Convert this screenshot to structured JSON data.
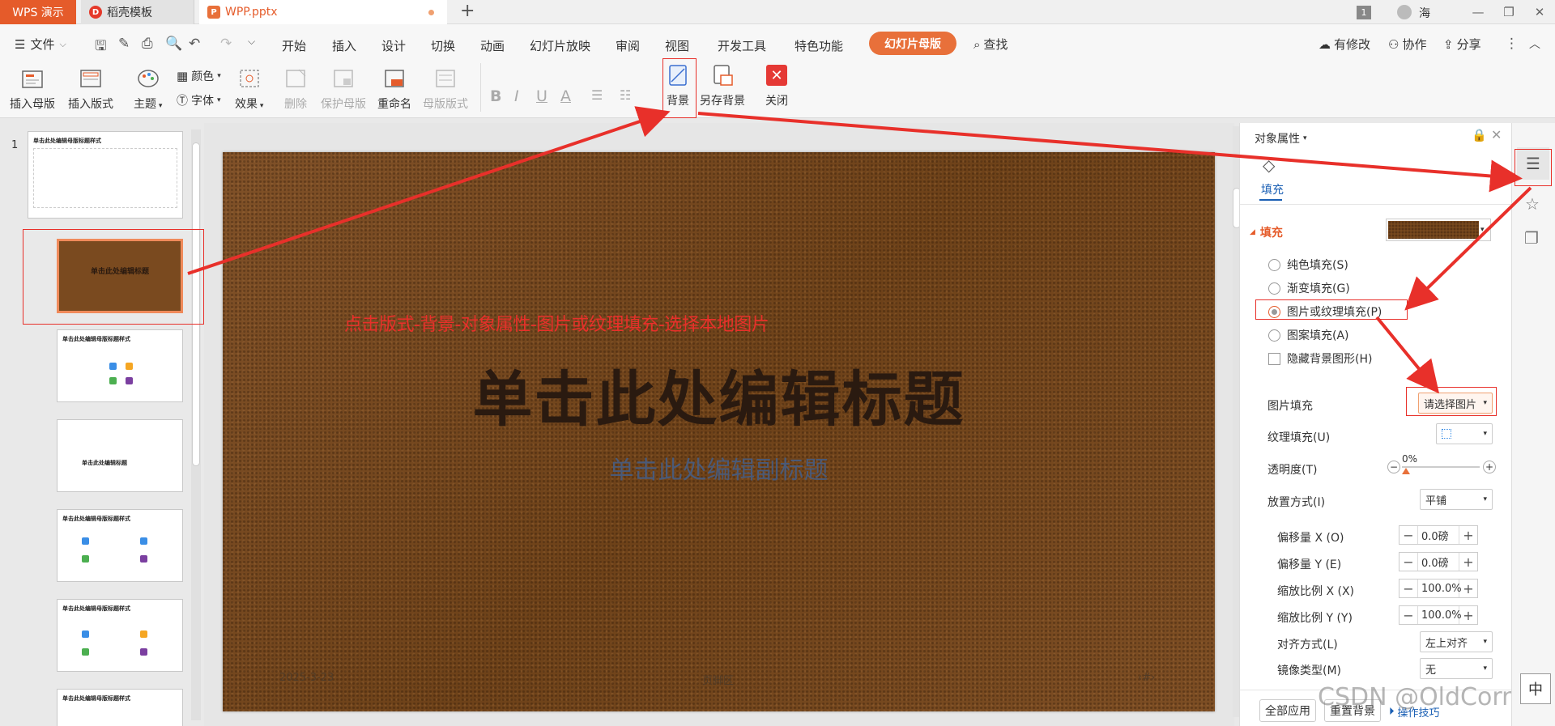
{
  "titlebar": {
    "brand": "WPS 演示",
    "tab1": "稻壳模板",
    "tab2": "WPP.pptx",
    "new_tab": "+",
    "page_num": "1",
    "user": "海",
    "min": "—",
    "restore": "❐",
    "close": "✕"
  },
  "menu": {
    "file": "文件",
    "items": [
      "开始",
      "插入",
      "设计",
      "切换",
      "动画",
      "幻灯片放映",
      "审阅",
      "视图",
      "开发工具",
      "特色功能"
    ],
    "active": "幻灯片母版",
    "search": "查找",
    "modified": "有修改",
    "collab": "协作",
    "share": "分享",
    "more": "⋮",
    "collapse": "︿"
  },
  "ribbon": {
    "insert_master": "插入母版",
    "insert_layout": "插入版式",
    "theme": "主题",
    "color": "颜色",
    "font": "字体",
    "effect": "效果",
    "delete": "删除",
    "protect": "保护母版",
    "rename": "重命名",
    "master_layout": "母版版式",
    "bold": "B",
    "italic": "I",
    "underline": "U",
    "fontcolor": "A",
    "background": "背景",
    "save_bg": "另存背景",
    "close": "关闭"
  },
  "thumbs": {
    "number": "1",
    "t1": "单击此处编辑母版标题样式",
    "t2": "单击此处编辑标题",
    "t3": "单击此处编辑母版标题样式",
    "t4": "单击此处编辑标题",
    "t5": "单击此处编辑母版标题样式",
    "t6": "单击此处编辑母版标题样式",
    "t7": "单击此处编辑母版标题样式"
  },
  "slide": {
    "annotation": "点击版式-背景-对象属性-图片或纹理填充-选择本地图片",
    "title": "单击此处编辑标题",
    "subtitle": "单击此处编辑副标题",
    "date": "2025-3-23",
    "footer": "页脚区",
    "page": "‹#›"
  },
  "pane": {
    "header": "对象属性",
    "tab_fill": "填充",
    "section": "填充",
    "opt_solid": "纯色填充(S)",
    "opt_gradient": "渐变填充(G)",
    "opt_picture": "图片或纹理填充(P)",
    "opt_pattern": "图案填充(A)",
    "opt_hide": "隐藏背景图形(H)",
    "pic_fill_label": "图片填充",
    "pic_fill_value": "请选择图片",
    "texture_label": "纹理填充(U)",
    "transparency_label": "透明度(T)",
    "transparency_value": "0%",
    "placement_label": "放置方式(I)",
    "placement_value": "平铺",
    "offset_x_label": "偏移量 X (O)",
    "offset_x": "0.0磅",
    "offset_y_label": "偏移量 Y (E)",
    "offset_y": "0.0磅",
    "scale_x_label": "缩放比例 X (X)",
    "scale_x": "100.0%",
    "scale_y_label": "缩放比例 Y (Y)",
    "scale_y": "100.0%",
    "align_label": "对齐方式(L)",
    "align_value": "左上对齐",
    "mirror_label": "镜像类型(M)",
    "mirror_value": "无",
    "apply_all": "全部应用",
    "reset_bg": "重置背景",
    "tips": "操作技巧"
  },
  "watermark": "CSDN @OldCorrect",
  "ime": "中"
}
